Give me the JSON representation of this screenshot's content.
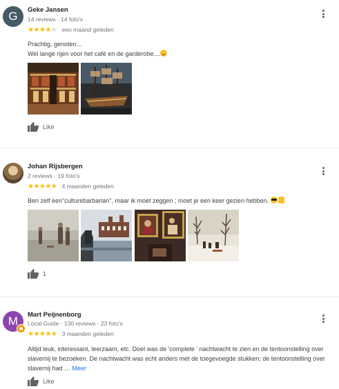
{
  "reviews": [
    {
      "author": "Geke Jansen",
      "avatar_letter": "G",
      "avatar_color": "#455a64",
      "meta": "14 reviews · 14 foto's",
      "rating": 4,
      "when": "een maand geleden",
      "text_line1": "Prachtig, genoten...",
      "text_line2": "Wel lange rijen voor het café en de garderobe....",
      "like_label": "Like"
    },
    {
      "author": "Johan Rijsbergen",
      "meta": "2 reviews · 19 foto's",
      "rating": 5,
      "when": "4 maanden geleden",
      "text": "Ben zelf een\"culturebarbarian\", maar ik moet zeggen ; moet je een keer gezien hebben.",
      "like_count": "1"
    },
    {
      "author": "Mart Peijnenborg",
      "avatar_letter": "M",
      "avatar_color": "#8e44ad",
      "meta": "Local Guide · 130 reviews · 23 foto's",
      "rating": 5,
      "when": "3 maanden geleden",
      "text": "Altijd leuk, interessant, leerzaam, etc. Doel was de 'complete ' nachtwacht te zien en de tentoonstelling over slavernij te bezoeken. De nachtwacht was echt anders met de toegevoegde stukken; de tentoonstelling over slavernij had …",
      "more_label": "Meer",
      "like_label": "Like"
    }
  ],
  "icons": {
    "like": "thumbs-up-icon",
    "menu": "more-vert-icon",
    "star": "star-icon"
  },
  "colors": {
    "star": "#fbbc04",
    "link": "#1a73e8",
    "local_guide_badge": "#f29900"
  }
}
